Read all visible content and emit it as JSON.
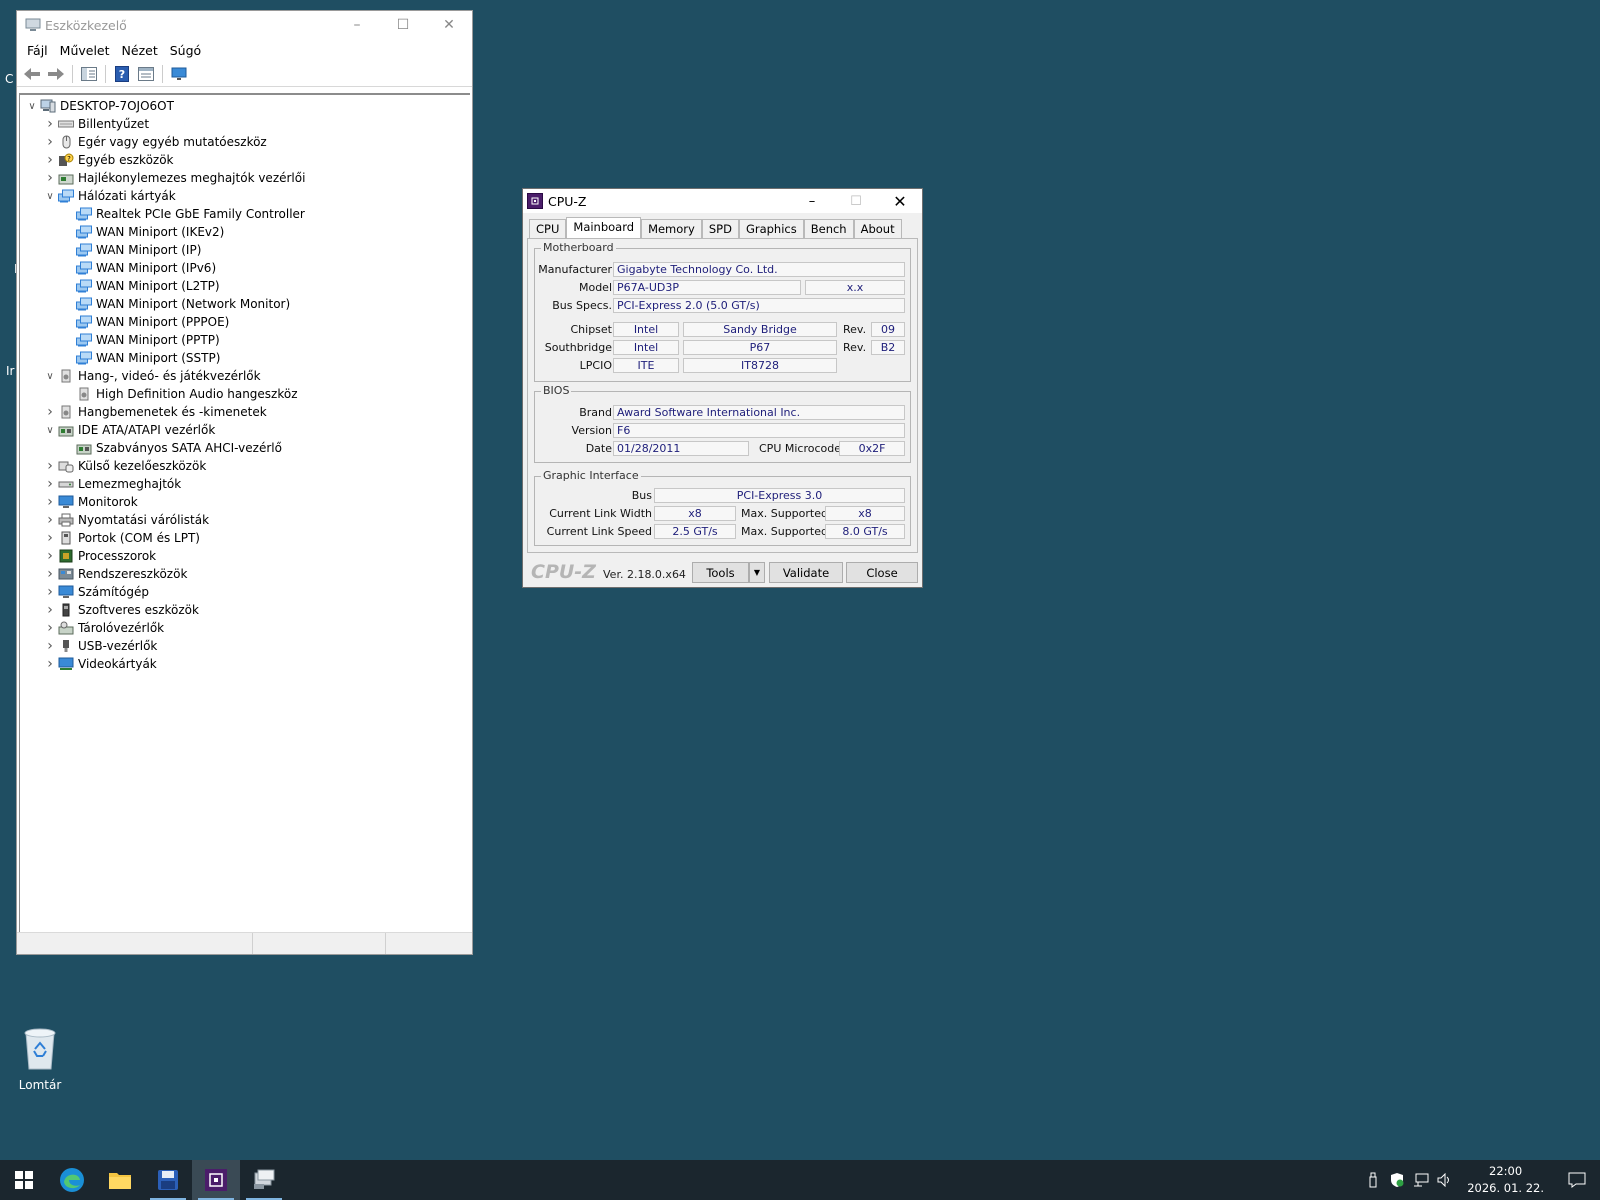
{
  "device_manager": {
    "title": "Eszközkezelő",
    "menu": [
      "Fájl",
      "Művelet",
      "Nézet",
      "Súgó"
    ],
    "tree": [
      {
        "label": "DESKTOP-7OJO6OT",
        "level": 0,
        "state": "expanded",
        "icon": "computer-icon"
      },
      {
        "label": "Billentyűzet",
        "level": 1,
        "state": "collapsed",
        "icon": "keyboard-icon"
      },
      {
        "label": "Egér vagy egyéb mutatóeszköz",
        "level": 1,
        "state": "collapsed",
        "icon": "mouse-icon"
      },
      {
        "label": "Egyéb eszközök",
        "level": 1,
        "state": "collapsed",
        "icon": "unknown-device-icon"
      },
      {
        "label": "Hajlékonylemezes meghajtók vezérlői",
        "level": 1,
        "state": "collapsed",
        "icon": "floppy-controller-icon"
      },
      {
        "label": "Hálózati kártyák",
        "level": 1,
        "state": "expanded",
        "icon": "network-adapter-icon"
      },
      {
        "label": "Realtek PCIe GbE Family Controller",
        "level": 2,
        "state": "leaf",
        "icon": "network-adapter-icon"
      },
      {
        "label": "WAN Miniport (IKEv2)",
        "level": 2,
        "state": "leaf",
        "icon": "network-adapter-icon"
      },
      {
        "label": "WAN Miniport (IP)",
        "level": 2,
        "state": "leaf",
        "icon": "network-adapter-icon"
      },
      {
        "label": "WAN Miniport (IPv6)",
        "level": 2,
        "state": "leaf",
        "icon": "network-adapter-icon"
      },
      {
        "label": "WAN Miniport (L2TP)",
        "level": 2,
        "state": "leaf",
        "icon": "network-adapter-icon"
      },
      {
        "label": "WAN Miniport (Network Monitor)",
        "level": 2,
        "state": "leaf",
        "icon": "network-adapter-icon"
      },
      {
        "label": "WAN Miniport (PPPOE)",
        "level": 2,
        "state": "leaf",
        "icon": "network-adapter-icon"
      },
      {
        "label": "WAN Miniport (PPTP)",
        "level": 2,
        "state": "leaf",
        "icon": "network-adapter-icon"
      },
      {
        "label": "WAN Miniport (SSTP)",
        "level": 2,
        "state": "leaf",
        "icon": "network-adapter-icon"
      },
      {
        "label": "Hang-, videó- és játékvezérlők",
        "level": 1,
        "state": "expanded",
        "icon": "speaker-icon"
      },
      {
        "label": "High Definition Audio hangeszköz",
        "level": 2,
        "state": "leaf",
        "icon": "speaker-icon"
      },
      {
        "label": "Hangbemenetek és -kimenetek",
        "level": 1,
        "state": "collapsed",
        "icon": "speaker-icon"
      },
      {
        "label": "IDE ATA/ATAPI vezérlők",
        "level": 1,
        "state": "expanded",
        "icon": "ide-controller-icon"
      },
      {
        "label": "Szabványos SATA AHCI-vezérlő",
        "level": 2,
        "state": "leaf",
        "icon": "ide-controller-icon"
      },
      {
        "label": "Külső kezelőeszközök",
        "level": 1,
        "state": "collapsed",
        "icon": "hid-icon"
      },
      {
        "label": "Lemezmeghajtók",
        "level": 1,
        "state": "collapsed",
        "icon": "disk-drive-icon"
      },
      {
        "label": "Monitorok",
        "level": 1,
        "state": "collapsed",
        "icon": "monitor-icon"
      },
      {
        "label": "Nyomtatási várólisták",
        "level": 1,
        "state": "collapsed",
        "icon": "printer-icon"
      },
      {
        "label": "Portok (COM és LPT)",
        "level": 1,
        "state": "collapsed",
        "icon": "port-icon"
      },
      {
        "label": "Processzorok",
        "level": 1,
        "state": "collapsed",
        "icon": "processor-icon"
      },
      {
        "label": "Rendszereszközök",
        "level": 1,
        "state": "collapsed",
        "icon": "system-device-icon"
      },
      {
        "label": "Számítógép",
        "level": 1,
        "state": "collapsed",
        "icon": "monitor-icon"
      },
      {
        "label": "Szoftveres eszközök",
        "level": 1,
        "state": "collapsed",
        "icon": "software-device-icon"
      },
      {
        "label": "Tárolóvezérlők",
        "level": 1,
        "state": "collapsed",
        "icon": "storage-controller-icon"
      },
      {
        "label": "USB-vezérlők",
        "level": 1,
        "state": "collapsed",
        "icon": "usb-icon"
      },
      {
        "label": "Videokártyák",
        "level": 1,
        "state": "collapsed",
        "icon": "display-adapter-icon"
      }
    ]
  },
  "cpuz": {
    "title": "CPU-Z",
    "tabs": [
      "CPU",
      "Mainboard",
      "Memory",
      "SPD",
      "Graphics",
      "Bench",
      "About"
    ],
    "active_tab": "Mainboard",
    "motherboard": {
      "group_label": "Motherboard",
      "manufacturer_label": "Manufacturer",
      "manufacturer": "Gigabyte Technology Co. Ltd.",
      "model_label": "Model",
      "model": "P67A-UD3P",
      "model_rev": "x.x",
      "bus_specs_label": "Bus Specs.",
      "bus_specs": "PCI-Express 2.0 (5.0 GT/s)",
      "chipset_label": "Chipset",
      "chipset_vendor": "Intel",
      "chipset_name": "Sandy Bridge",
      "chipset_rev_label": "Rev.",
      "chipset_rev": "09",
      "southbridge_label": "Southbridge",
      "southbridge_vendor": "Intel",
      "southbridge_name": "P67",
      "southbridge_rev_label": "Rev.",
      "southbridge_rev": "B2",
      "lpcio_label": "LPCIO",
      "lpcio_vendor": "ITE",
      "lpcio_name": "IT8728"
    },
    "bios": {
      "group_label": "BIOS",
      "brand_label": "Brand",
      "brand": "Award Software International Inc.",
      "version_label": "Version",
      "version": "F6",
      "date_label": "Date",
      "date": "01/28/2011",
      "microcode_label": "CPU Microcode",
      "microcode": "0x2F"
    },
    "graphic_interface": {
      "group_label": "Graphic Interface",
      "bus_label": "Bus",
      "bus": "PCI-Express 3.0",
      "link_width_label": "Current Link Width",
      "link_width": "x8",
      "max_width_label": "Max. Supported",
      "max_width": "x8",
      "link_speed_label": "Current Link Speed",
      "link_speed": "2.5 GT/s",
      "max_speed_label": "Max. Supported",
      "max_speed": "8.0 GT/s"
    },
    "footer": {
      "logo": "CPU-Z",
      "version": "Ver. 2.18.0.x64",
      "tools_label": "Tools",
      "validate_label": "Validate",
      "close_label": "Close"
    }
  },
  "desktop": {
    "recycle_bin_label": "Lomtár",
    "peek_fragments": [
      "C",
      "I",
      "Ir"
    ]
  },
  "taskbar": {
    "time": "22:00",
    "date": "2026. 01. 22.",
    "pinned": [
      "start-icon",
      "edge-icon",
      "file-explorer-icon",
      "save-disk-icon",
      "cpuz-icon",
      "device-manager-icon"
    ]
  },
  "colors": {
    "desktop_bg": "#1f4e62",
    "taskbar_bg": "#1b262e",
    "cpuz_value_text": "#1e1e7a",
    "network_icon": "#2f7fd6"
  }
}
